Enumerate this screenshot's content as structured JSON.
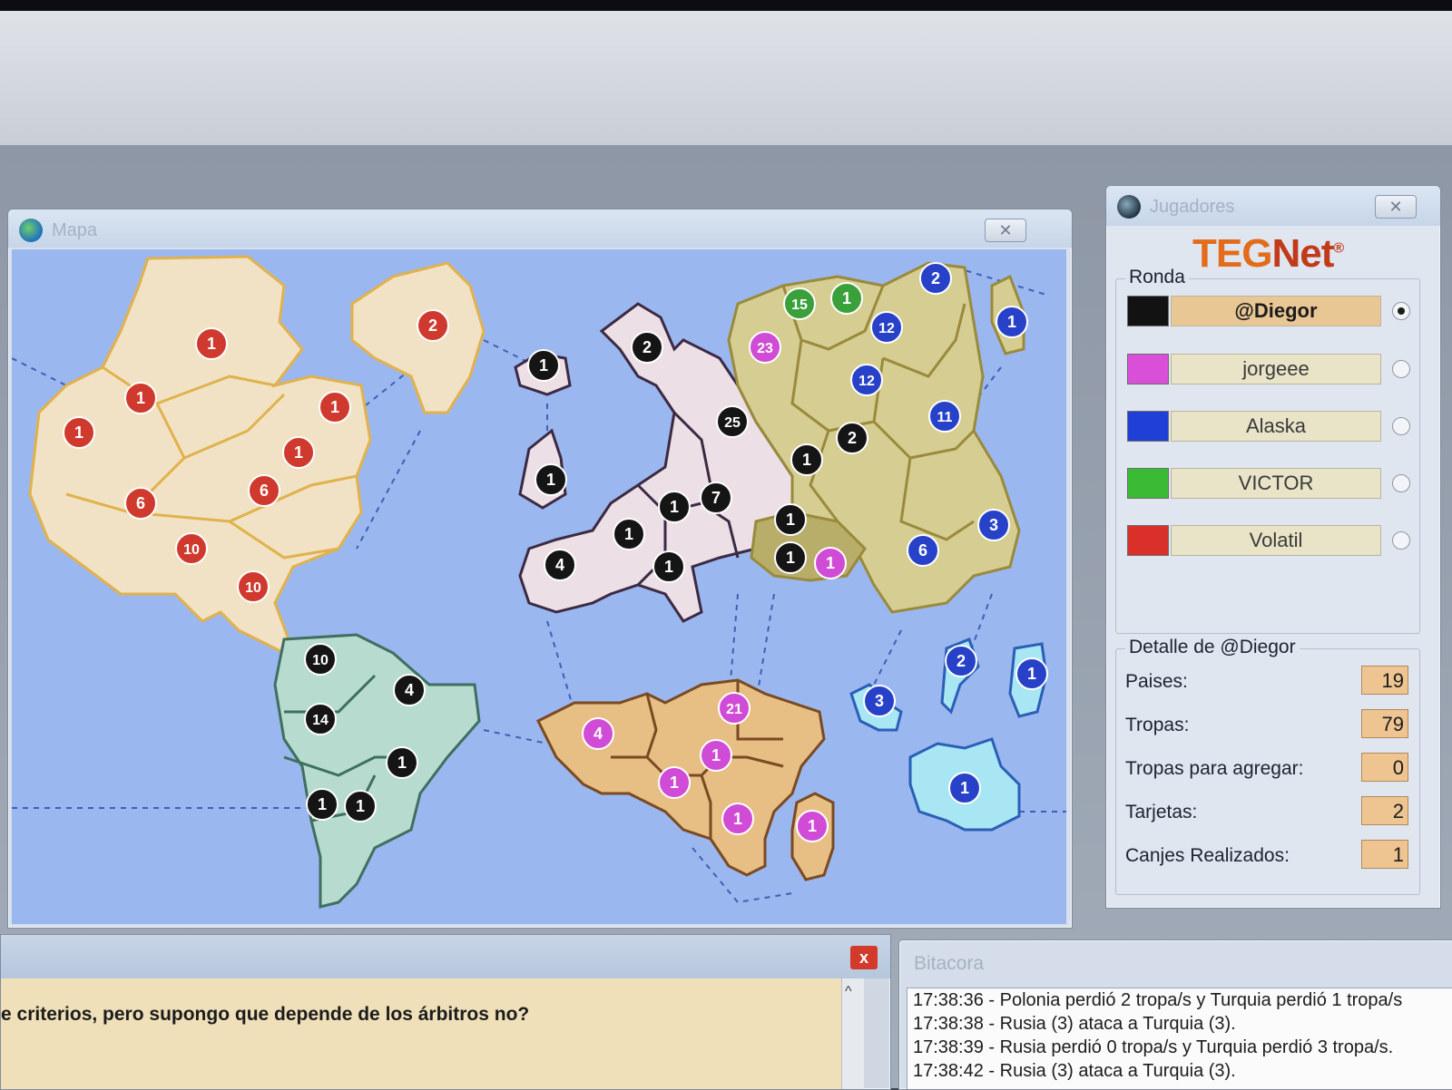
{
  "map_window": {
    "title": "Mapa",
    "close_icon": "close-icon",
    "colors": {
      "ocean": "#9bb7ef",
      "north_america": "#f1e2c6",
      "south_america": "#b7dccf",
      "europe": "#ece0e6",
      "asia": "#d5cd92",
      "africa": "#e7bf84",
      "oceania": "#a8e6f4"
    },
    "armies": [
      {
        "v": "1",
        "c": "#d03a2e"
      },
      {
        "v": "1",
        "c": "#d03a2e"
      },
      {
        "v": "1",
        "c": "#d03a2e"
      },
      {
        "v": "2",
        "c": "#d03a2e"
      },
      {
        "v": "1",
        "c": "#d03a2e"
      },
      {
        "v": "1",
        "c": "#d03a2e"
      },
      {
        "v": "6",
        "c": "#d03a2e"
      },
      {
        "v": "6",
        "c": "#d03a2e"
      },
      {
        "v": "10",
        "c": "#d03a2e"
      },
      {
        "v": "10",
        "c": "#d03a2e"
      },
      {
        "v": "10",
        "c": "#151515"
      },
      {
        "v": "4",
        "c": "#151515"
      },
      {
        "v": "14",
        "c": "#151515"
      },
      {
        "v": "1",
        "c": "#151515"
      },
      {
        "v": "1",
        "c": "#151515"
      },
      {
        "v": "1",
        "c": "#151515"
      },
      {
        "v": "1",
        "c": "#151515"
      },
      {
        "v": "2",
        "c": "#151515"
      },
      {
        "v": "1",
        "c": "#151515"
      },
      {
        "v": "25",
        "c": "#151515"
      },
      {
        "v": "1",
        "c": "#151515"
      },
      {
        "v": "7",
        "c": "#151515"
      },
      {
        "v": "1",
        "c": "#151515"
      },
      {
        "v": "4",
        "c": "#151515"
      },
      {
        "v": "1",
        "c": "#151515"
      },
      {
        "v": "1",
        "c": "#151515"
      },
      {
        "v": "1",
        "c": "#151515"
      },
      {
        "v": "1",
        "c": "#151515"
      },
      {
        "v": "2",
        "c": "#151515"
      },
      {
        "v": "15",
        "c": "#3aa03a"
      },
      {
        "v": "1",
        "c": "#3aa03a"
      },
      {
        "v": "2",
        "c": "#2742c8"
      },
      {
        "v": "12",
        "c": "#2742c8"
      },
      {
        "v": "12",
        "c": "#2742c8"
      },
      {
        "v": "1",
        "c": "#2742c8"
      },
      {
        "v": "11",
        "c": "#2742c8"
      },
      {
        "v": "3",
        "c": "#2742c8"
      },
      {
        "v": "6",
        "c": "#2742c8"
      },
      {
        "v": "2",
        "c": "#2742c8"
      },
      {
        "v": "3",
        "c": "#2742c8"
      },
      {
        "v": "1",
        "c": "#2742c8"
      },
      {
        "v": "1",
        "c": "#2742c8"
      },
      {
        "v": "23",
        "c": "#d04bd6"
      },
      {
        "v": "1",
        "c": "#d04bd6"
      },
      {
        "v": "4",
        "c": "#d04bd6"
      },
      {
        "v": "21",
        "c": "#d04bd6"
      },
      {
        "v": "1",
        "c": "#d04bd6"
      },
      {
        "v": "1",
        "c": "#d04bd6"
      },
      {
        "v": "1",
        "c": "#d04bd6"
      },
      {
        "v": "1",
        "c": "#d04bd6"
      }
    ]
  },
  "players_window": {
    "title": "Jugadores",
    "close_icon": "close-icon",
    "logo_teg": "TEG",
    "logo_net": "Net",
    "logo_mark": "®",
    "round_label": "Ronda",
    "players": [
      {
        "name": "@Diegor",
        "color": "#121212",
        "selected": true
      },
      {
        "name": "jorgeee",
        "color": "#d94fd8",
        "selected": false
      },
      {
        "name": "Alaska",
        "color": "#1f3fd6",
        "selected": false
      },
      {
        "name": "VICTOR",
        "color": "#3bbb35",
        "selected": false
      },
      {
        "name": "Volatil",
        "color": "#d9312a",
        "selected": false
      }
    ],
    "detail_label": "Detalle de @Diegor",
    "details": [
      {
        "label": "Paises:",
        "value": "19"
      },
      {
        "label": "Tropas:",
        "value": "79"
      },
      {
        "label": "Tropas para agregar:",
        "value": "0"
      },
      {
        "label": "Tarjetas:",
        "value": "2"
      },
      {
        "label": "Canjes Realizados:",
        "value": "1"
      }
    ]
  },
  "chat_window": {
    "close_label": "x",
    "message": "e criterios, pero supongo que depende de los árbitros no?",
    "scroll_up": "^"
  },
  "log_window": {
    "title": "Bitacora",
    "lines": [
      "17:38:36 - Polonia perdió 2 tropa/s y Turquia perdió 1 tropa/s",
      "17:38:38 - Rusia (3) ataca a Turquia (3).",
      "17:38:39 - Rusia perdió 0 tropa/s y Turquia perdió 3 tropa/s.",
      "17:38:42 - Rusia (3) ataca a Turquia (3)."
    ]
  }
}
